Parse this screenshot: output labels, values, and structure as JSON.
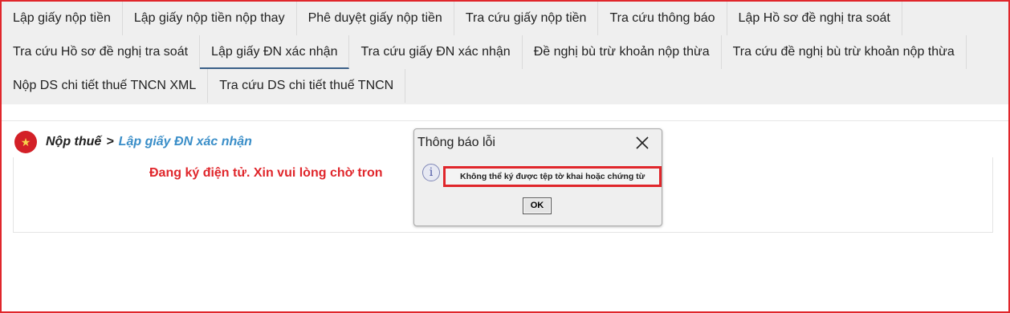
{
  "tabs": {
    "row1": [
      "Lập giấy nộp tiền",
      "Lập giấy nộp tiền nộp thay",
      "Phê duyệt giấy nộp tiền",
      "Tra cứu giấy nộp tiền",
      "Tra cứu thông báo",
      "Lập Hồ sơ đề nghị tra soát"
    ],
    "row2": [
      "Tra cứu Hồ sơ đề nghị tra soát",
      "Lập giấy ĐN xác nhận",
      "Tra cứu giấy ĐN xác nhận",
      "Đề nghị bù trừ khoản nộp thừa",
      "Tra cứu đề nghị bù trừ khoản nộp thừa"
    ],
    "row3": [
      "Nộp DS chi tiết thuế TNCN XML",
      "Tra cứu DS chi tiết thuế TNCN"
    ],
    "active": "Lập giấy ĐN xác nhận"
  },
  "breadcrumb": {
    "root": "Nộp thuế",
    "separator": ">",
    "current": "Lập giấy ĐN xác nhận"
  },
  "status_message": "Đang ký điện tử. Xin vui lòng chờ tron",
  "dialog": {
    "title": "Thông báo lỗi",
    "message": "Không thể ký được tệp tờ khai hoặc chứng từ",
    "ok_label": "OK",
    "info_glyph": "i",
    "icon": "info-icon"
  },
  "colors": {
    "highlight": "#e0262b",
    "breadcrumb_link": "#3a8ec8",
    "active_tab_underline": "#3a5f88"
  }
}
